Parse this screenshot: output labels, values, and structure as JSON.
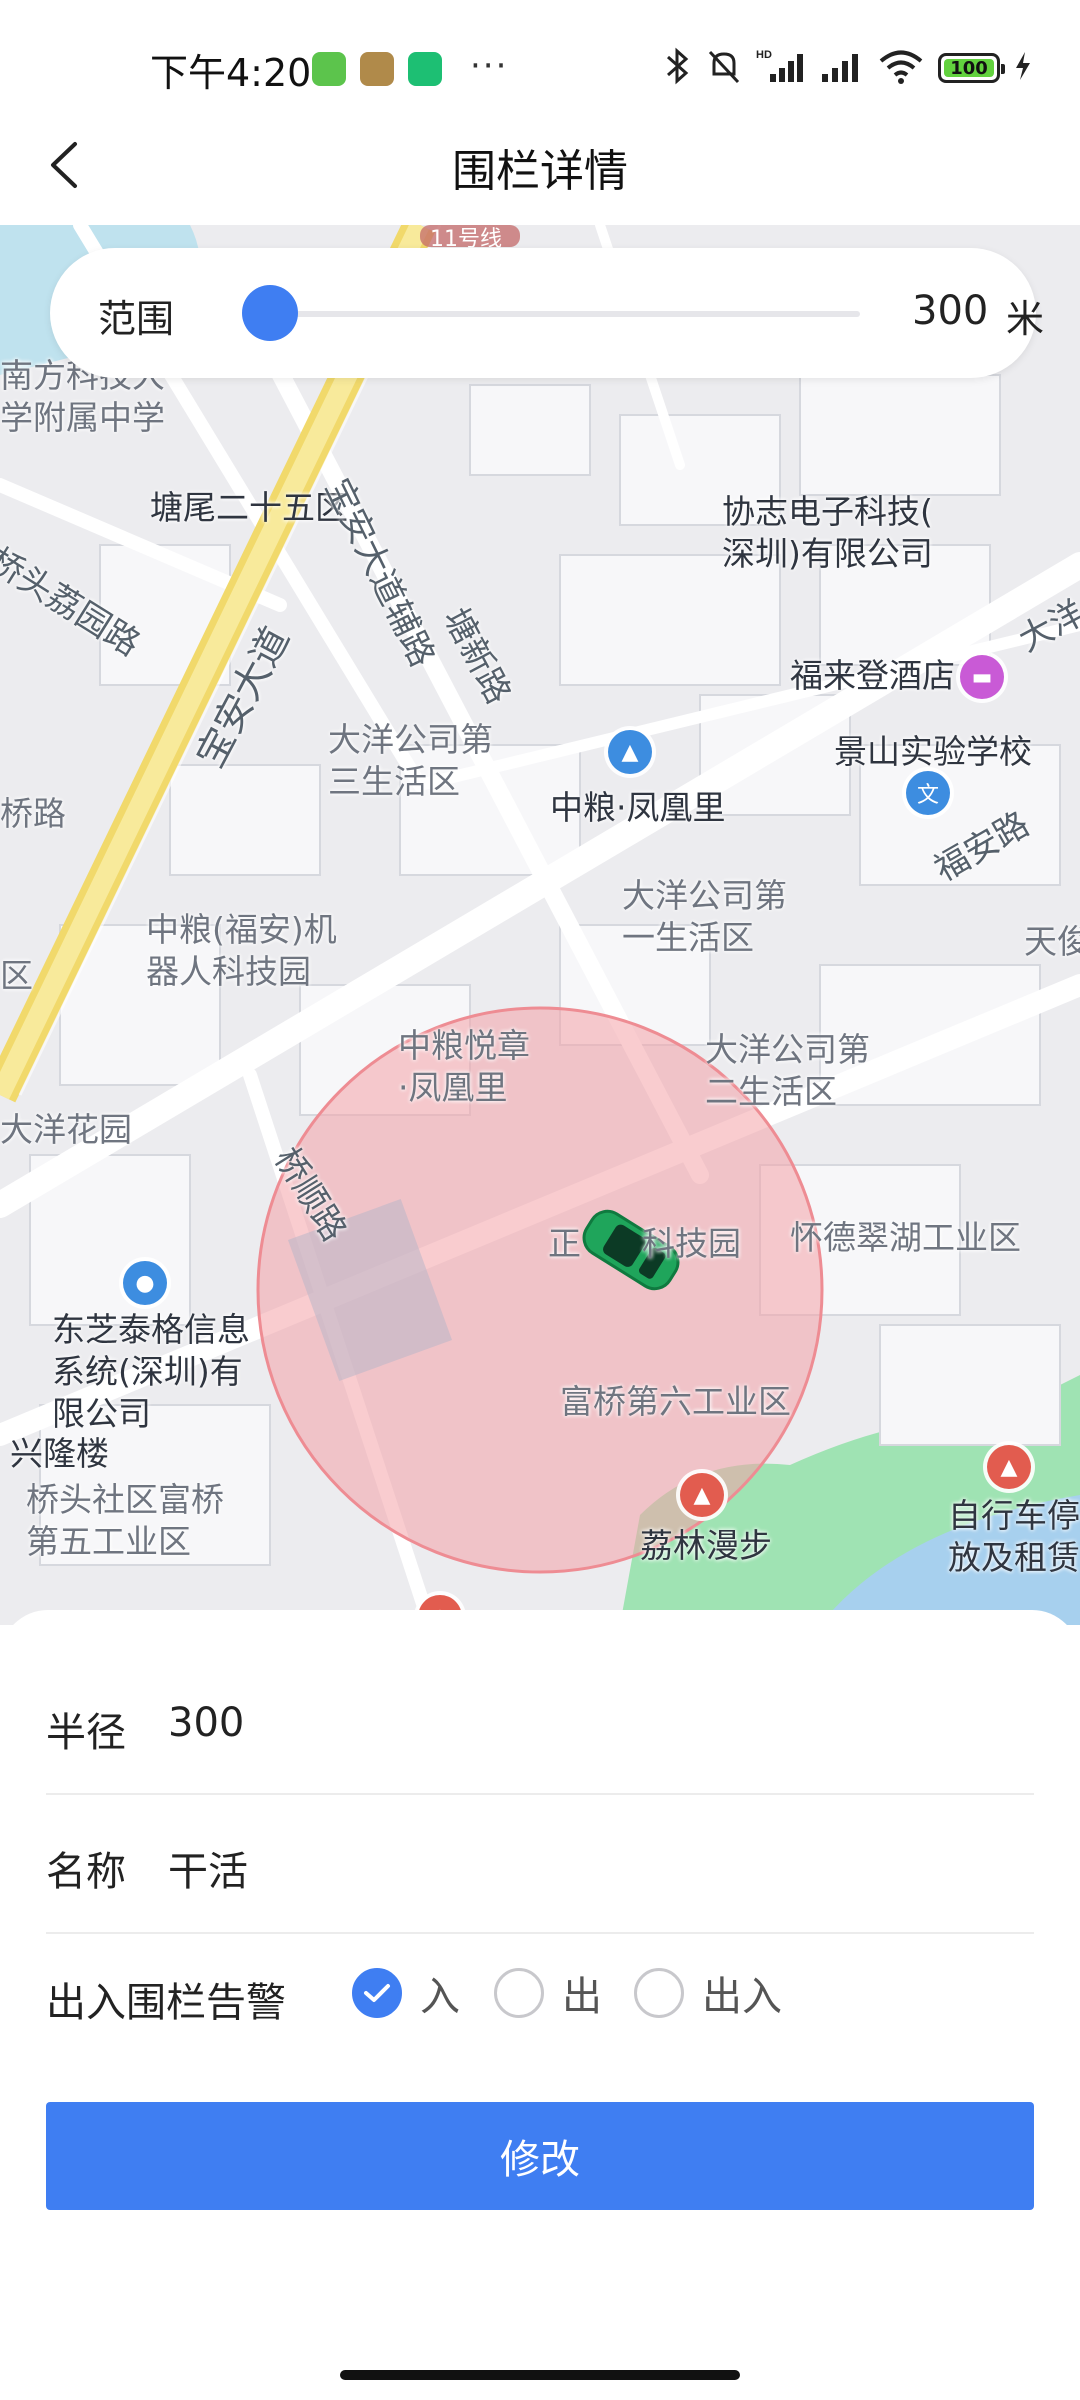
{
  "status_bar": {
    "time": "下午4:20",
    "battery": "100"
  },
  "header": {
    "title": "围栏详情"
  },
  "range": {
    "label": "范围",
    "value": "300",
    "unit": "米",
    "slider_level": 0.0
  },
  "map": {
    "labels": [
      "南方科技大\n学附属中学",
      "塘尾二十五区",
      "协志电子科技(\n深圳)有限公司",
      "福来登酒店",
      "景山实验学校",
      "大洋公司第\n三生活区",
      "中粮·凤凰里",
      "大洋公司第\n一生活区",
      "中粮(福安)机\n器人科技园",
      "中粮悦章\n·凤凰里",
      "大洋公司第\n二生活区",
      "大洋花园",
      "正",
      "科技园",
      "怀德翠湖工业区",
      "东芝泰格信息\n系统(深圳)有\n限公司",
      "富桥第六工业区",
      "兴隆楼",
      "桥头社区富桥\n第五工业区",
      "荔林漫步",
      "自行车停\n放及租赁",
      "天俊",
      "区",
      "桥路"
    ],
    "roads": [
      "桥头荔园路",
      "宝安大道辅路",
      "塘新路",
      "宝安大道",
      "福安路",
      "桥顺路",
      "大洋",
      "11号线"
    ],
    "fence_color": "#f4a3a8",
    "vehicle_color": "#1fa55b"
  },
  "form": {
    "radius_label": "半径",
    "radius_value": "300",
    "name_label": "名称",
    "name_value": "干活",
    "alarm_label": "出入围栏告警",
    "options": [
      {
        "label": "入",
        "checked": true
      },
      {
        "label": "出",
        "checked": false
      },
      {
        "label": "出入",
        "checked": false
      }
    ],
    "submit_label": "修改"
  },
  "colors": {
    "accent": "#3f7ef2"
  }
}
